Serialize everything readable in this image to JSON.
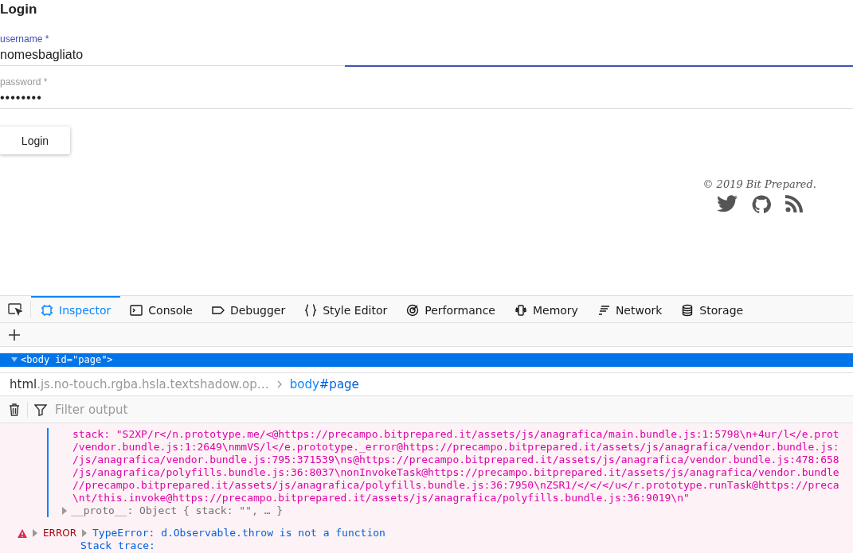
{
  "page": {
    "title": "Login",
    "fields": [
      {
        "kind": "text",
        "label": "username *",
        "value": "nomesbagliato",
        "focused": true
      },
      {
        "kind": "password",
        "label": "password *",
        "value": "••••••••",
        "focused": false
      }
    ],
    "button": "Login",
    "footer": {
      "copyright": "© 2019 Bit Prepared.",
      "links": [
        {
          "kind": "twitter"
        },
        {
          "kind": "github"
        },
        {
          "kind": "rss"
        }
      ]
    }
  },
  "devtools": {
    "tabs": [
      {
        "label": "Inspector",
        "selected": true
      },
      {
        "label": "Console",
        "selected": false
      },
      {
        "label": "Debugger",
        "selected": false
      },
      {
        "label": "Style Editor",
        "selected": false
      },
      {
        "label": "Performance",
        "selected": false
      },
      {
        "label": "Memory",
        "selected": false
      },
      {
        "label": "Network",
        "selected": false
      },
      {
        "label": "Storage",
        "selected": false
      }
    ],
    "markup": {
      "selected_node": "<body id=\"page\">"
    },
    "breadcrumbs": [
      {
        "tag": "html",
        "rest": ".js.no-touch.rgba.hsla.textshadow.op…",
        "selected": false
      },
      {
        "tag": "body",
        "rest": "#page",
        "selected": true
      }
    ],
    "filter": {
      "placeholder": "Filter output"
    },
    "console": {
      "stack_lines": [
        "stack: \"S2XP/r</n.prototype.me/<@https://precampo.bitprepared.it/assets/js/anagrafica/main.bundle.js:1:5798\\n+4ur/l</e.prot",
        "/vendor.bundle.js:1:2649\\nmmVS/l</e.prototype._error@https://precampo.bitprepared.it/assets/js/anagrafica/vendor.bundle.js:",
        "/js/anagrafica/vendor.bundle.js:795:371539\\ns@https://precampo.bitprepared.it/assets/js/anagrafica/vendor.bundle.js:478:658",
        "/js/anagrafica/polyfills.bundle.js:36:8037\\nonInvokeTask@https://precampo.bitprepared.it/assets/js/anagrafica/vendor.bundle",
        "//precampo.bitprepared.it/assets/js/anagrafica/polyfills.bundle.js:36:7950\\nZSR1/</</</u</r.prototype.runTask@https://preca",
        "\\nt/this.invoke@https://precampo.bitprepared.it/assets/js/anagrafica/polyfills.bundle.js:36:9019\\n\""
      ],
      "proto": "__proto__: Object { stack: \"\", … }",
      "error": {
        "level": "ERROR",
        "message": "TypeError: d.Observable.throw is not a function",
        "detail": "Stack trace:"
      }
    }
  }
}
